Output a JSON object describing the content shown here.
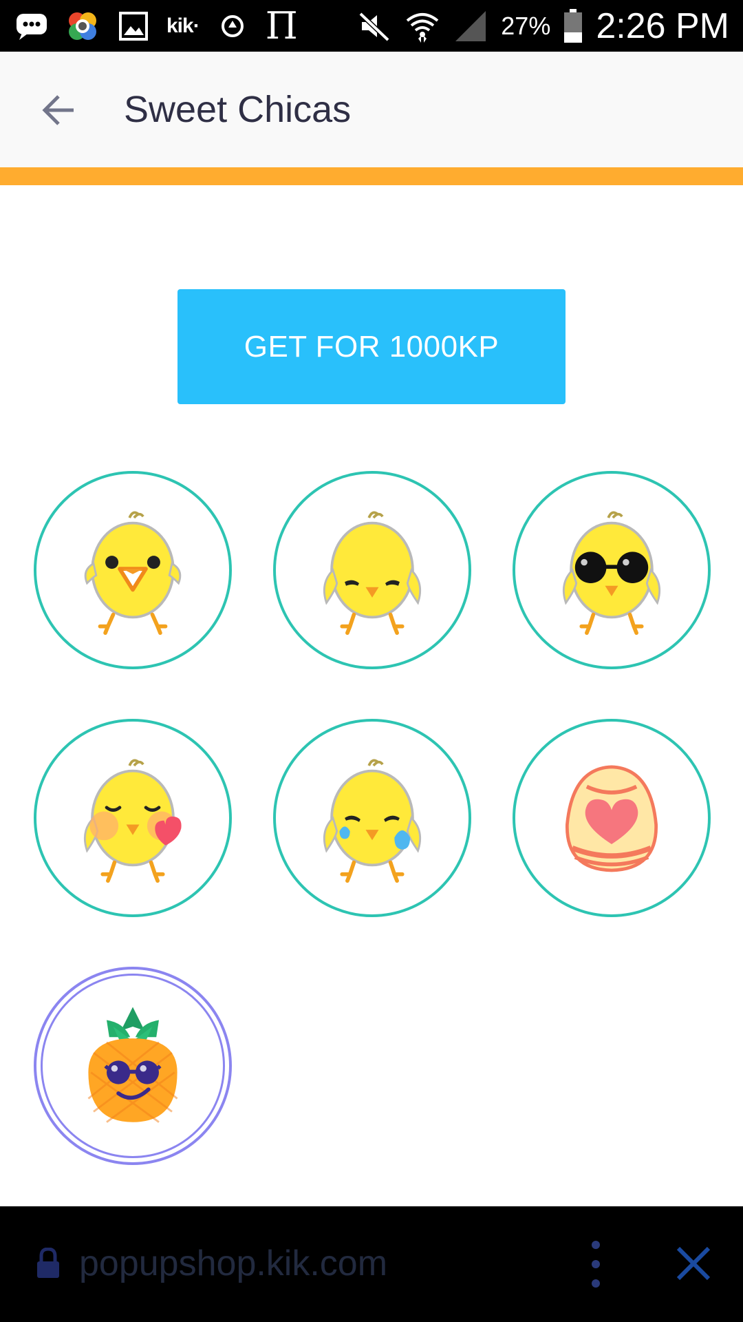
{
  "status_bar": {
    "left_icons": [
      "sms-icon",
      "pinwheel-app-icon",
      "gallery-icon",
      "kik-icon",
      "sync-icon",
      "pi-icon"
    ],
    "kik_label": "kik·",
    "pi_label": "Π",
    "battery_percent": "27%",
    "time": "2:26 PM"
  },
  "header": {
    "title": "Sweet Chicas",
    "accent_color": "#ffac2f"
  },
  "buy_button": {
    "label": "GET FOR 1000KP",
    "color": "#29c0fb"
  },
  "stickers": [
    {
      "name": "happy chick",
      "icon": "chick-happy-icon"
    },
    {
      "name": "sleepy chick",
      "icon": "chick-sleepy-icon"
    },
    {
      "name": "cool chick",
      "icon": "chick-sunglasses-icon"
    },
    {
      "name": "love chick",
      "icon": "chick-heart-icon"
    },
    {
      "name": "crying chick",
      "icon": "chick-crying-icon"
    },
    {
      "name": "heart egg",
      "icon": "egg-heart-icon"
    },
    {
      "name": "cool pineapple",
      "icon": "pineapple-sunglasses-icon",
      "selected": true
    }
  ],
  "colors": {
    "sticker_ring": "#2dc4b2",
    "selected_ring": "#8b85f0"
  },
  "url_bar": {
    "url": "popupshop.kik.com"
  }
}
